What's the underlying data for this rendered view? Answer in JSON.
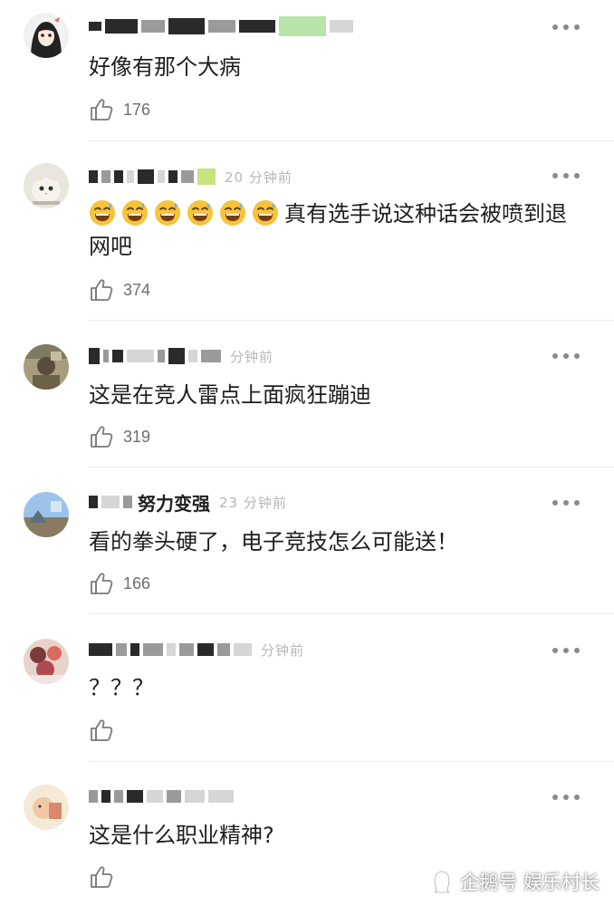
{
  "comments": [
    {
      "id": 1,
      "text": "好像有那个大病",
      "likes": "176",
      "time_fragment": "",
      "avatar": "anime-girl-avatar"
    },
    {
      "id": 2,
      "text_suffix": "真有选手说这种话会被喷到退网吧",
      "emoji_count": 6,
      "emoji": "grinning-sweat-emoji",
      "likes": "374",
      "time_fragment": "20 分钟前",
      "avatar": "cat-avatar"
    },
    {
      "id": 3,
      "text": "这是在竞人雷点上面疯狂蹦迪",
      "likes": "319",
      "time_fragment": "分钟前",
      "avatar": "person-avatar"
    },
    {
      "id": 4,
      "text": "看的拳头硬了，电子竞技怎么可能送！",
      "likes": "166",
      "name_fragment": "努力变强",
      "time_fragment": "23 分钟前",
      "avatar": "landscape-avatar"
    },
    {
      "id": 5,
      "text": "？？？",
      "likes": "",
      "time_fragment": "分钟前",
      "avatar": "flowers-avatar"
    },
    {
      "id": 6,
      "text": "这是什么职业精神?",
      "likes": "",
      "time_fragment": "",
      "avatar": "cartoon-avatar"
    }
  ],
  "watermark": {
    "text": "企鹅号 娱乐村长",
    "icon": "penguin-icon"
  },
  "colors": {
    "text": "#1e1e1e",
    "meta": "#6d6d6d",
    "divider": "#ececec",
    "dots": "#8a8a8a"
  }
}
